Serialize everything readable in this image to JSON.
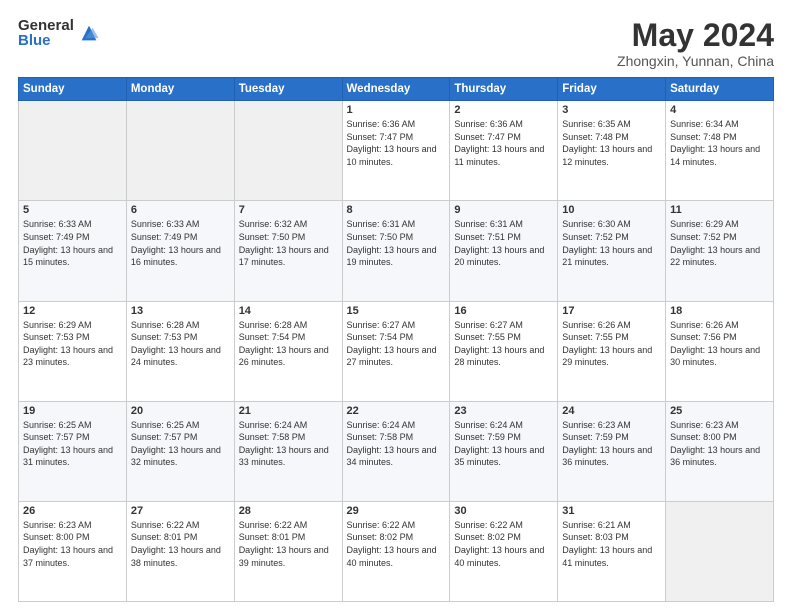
{
  "header": {
    "logo_general": "General",
    "logo_blue": "Blue",
    "month_year": "May 2024",
    "location": "Zhongxin, Yunnan, China"
  },
  "days_of_week": [
    "Sunday",
    "Monday",
    "Tuesday",
    "Wednesday",
    "Thursday",
    "Friday",
    "Saturday"
  ],
  "weeks": [
    [
      {
        "day": "",
        "info": ""
      },
      {
        "day": "",
        "info": ""
      },
      {
        "day": "",
        "info": ""
      },
      {
        "day": "1",
        "info": "Sunrise: 6:36 AM\nSunset: 7:47 PM\nDaylight: 13 hours and 10 minutes."
      },
      {
        "day": "2",
        "info": "Sunrise: 6:36 AM\nSunset: 7:47 PM\nDaylight: 13 hours and 11 minutes."
      },
      {
        "day": "3",
        "info": "Sunrise: 6:35 AM\nSunset: 7:48 PM\nDaylight: 13 hours and 12 minutes."
      },
      {
        "day": "4",
        "info": "Sunrise: 6:34 AM\nSunset: 7:48 PM\nDaylight: 13 hours and 14 minutes."
      }
    ],
    [
      {
        "day": "5",
        "info": "Sunrise: 6:33 AM\nSunset: 7:49 PM\nDaylight: 13 hours and 15 minutes."
      },
      {
        "day": "6",
        "info": "Sunrise: 6:33 AM\nSunset: 7:49 PM\nDaylight: 13 hours and 16 minutes."
      },
      {
        "day": "7",
        "info": "Sunrise: 6:32 AM\nSunset: 7:50 PM\nDaylight: 13 hours and 17 minutes."
      },
      {
        "day": "8",
        "info": "Sunrise: 6:31 AM\nSunset: 7:50 PM\nDaylight: 13 hours and 19 minutes."
      },
      {
        "day": "9",
        "info": "Sunrise: 6:31 AM\nSunset: 7:51 PM\nDaylight: 13 hours and 20 minutes."
      },
      {
        "day": "10",
        "info": "Sunrise: 6:30 AM\nSunset: 7:52 PM\nDaylight: 13 hours and 21 minutes."
      },
      {
        "day": "11",
        "info": "Sunrise: 6:29 AM\nSunset: 7:52 PM\nDaylight: 13 hours and 22 minutes."
      }
    ],
    [
      {
        "day": "12",
        "info": "Sunrise: 6:29 AM\nSunset: 7:53 PM\nDaylight: 13 hours and 23 minutes."
      },
      {
        "day": "13",
        "info": "Sunrise: 6:28 AM\nSunset: 7:53 PM\nDaylight: 13 hours and 24 minutes."
      },
      {
        "day": "14",
        "info": "Sunrise: 6:28 AM\nSunset: 7:54 PM\nDaylight: 13 hours and 26 minutes."
      },
      {
        "day": "15",
        "info": "Sunrise: 6:27 AM\nSunset: 7:54 PM\nDaylight: 13 hours and 27 minutes."
      },
      {
        "day": "16",
        "info": "Sunrise: 6:27 AM\nSunset: 7:55 PM\nDaylight: 13 hours and 28 minutes."
      },
      {
        "day": "17",
        "info": "Sunrise: 6:26 AM\nSunset: 7:55 PM\nDaylight: 13 hours and 29 minutes."
      },
      {
        "day": "18",
        "info": "Sunrise: 6:26 AM\nSunset: 7:56 PM\nDaylight: 13 hours and 30 minutes."
      }
    ],
    [
      {
        "day": "19",
        "info": "Sunrise: 6:25 AM\nSunset: 7:57 PM\nDaylight: 13 hours and 31 minutes."
      },
      {
        "day": "20",
        "info": "Sunrise: 6:25 AM\nSunset: 7:57 PM\nDaylight: 13 hours and 32 minutes."
      },
      {
        "day": "21",
        "info": "Sunrise: 6:24 AM\nSunset: 7:58 PM\nDaylight: 13 hours and 33 minutes."
      },
      {
        "day": "22",
        "info": "Sunrise: 6:24 AM\nSunset: 7:58 PM\nDaylight: 13 hours and 34 minutes."
      },
      {
        "day": "23",
        "info": "Sunrise: 6:24 AM\nSunset: 7:59 PM\nDaylight: 13 hours and 35 minutes."
      },
      {
        "day": "24",
        "info": "Sunrise: 6:23 AM\nSunset: 7:59 PM\nDaylight: 13 hours and 36 minutes."
      },
      {
        "day": "25",
        "info": "Sunrise: 6:23 AM\nSunset: 8:00 PM\nDaylight: 13 hours and 36 minutes."
      }
    ],
    [
      {
        "day": "26",
        "info": "Sunrise: 6:23 AM\nSunset: 8:00 PM\nDaylight: 13 hours and 37 minutes."
      },
      {
        "day": "27",
        "info": "Sunrise: 6:22 AM\nSunset: 8:01 PM\nDaylight: 13 hours and 38 minutes."
      },
      {
        "day": "28",
        "info": "Sunrise: 6:22 AM\nSunset: 8:01 PM\nDaylight: 13 hours and 39 minutes."
      },
      {
        "day": "29",
        "info": "Sunrise: 6:22 AM\nSunset: 8:02 PM\nDaylight: 13 hours and 40 minutes."
      },
      {
        "day": "30",
        "info": "Sunrise: 6:22 AM\nSunset: 8:02 PM\nDaylight: 13 hours and 40 minutes."
      },
      {
        "day": "31",
        "info": "Sunrise: 6:21 AM\nSunset: 8:03 PM\nDaylight: 13 hours and 41 minutes."
      },
      {
        "day": "",
        "info": ""
      }
    ]
  ]
}
